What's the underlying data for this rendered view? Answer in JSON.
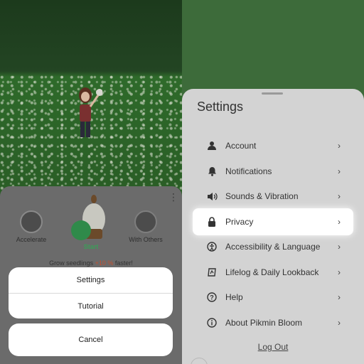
{
  "left": {
    "modes": {
      "accelerate": "Accelerate",
      "start": "Start",
      "with_others": "With Others"
    },
    "promo": {
      "prefix": "Grow seedlings",
      "highlight": "+10 %",
      "suffix": "faster!"
    },
    "action_sheet": {
      "settings": "Settings",
      "tutorial": "Tutorial",
      "cancel": "Cancel"
    }
  },
  "settings": {
    "title": "Settings",
    "items": [
      {
        "label": "Account",
        "icon": "person-icon"
      },
      {
        "label": "Notifications",
        "icon": "bell-icon"
      },
      {
        "label": "Sounds & Vibration",
        "icon": "speaker-icon"
      },
      {
        "label": "Privacy",
        "icon": "lock-icon",
        "highlighted": true
      },
      {
        "label": "Accessibility & Language",
        "icon": "accessibility-icon"
      },
      {
        "label": "Lifelog & Daily Lookback",
        "icon": "lifelog-icon"
      },
      {
        "label": "Help",
        "icon": "help-icon"
      },
      {
        "label": "About Pikmin Bloom",
        "icon": "info-icon"
      }
    ],
    "logout": "Log Out"
  },
  "colors": {
    "start_green": "#3b9e58",
    "promo_accent": "#c25030",
    "highlight_row": "#ffffff"
  }
}
